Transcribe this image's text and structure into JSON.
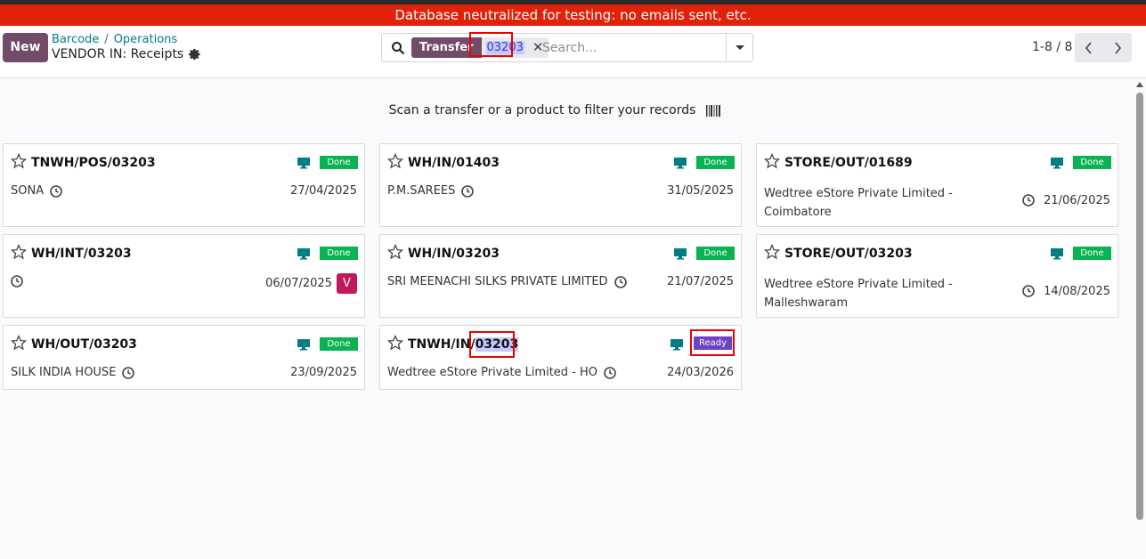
{
  "banner": {
    "text": "Database neutralized for testing: no emails sent, etc."
  },
  "control_panel": {
    "new_label": "New",
    "breadcrumbs": [
      "Barcode",
      "Operations"
    ],
    "breadcrumb_separator": "/",
    "subtitle": "VENDOR IN: Receipts"
  },
  "search": {
    "facet_label": "Transfer",
    "facet_value": "03203",
    "placeholder": "Search..."
  },
  "pager": {
    "value": "1-8 / 8"
  },
  "scan_hint": "Scan a transfer or a product to filter your records",
  "cards": [
    {
      "name": "TNWH/POS/03203",
      "status": "Done",
      "partner": "SONA",
      "date": "27/04/2025"
    },
    {
      "name": "WH/IN/01403",
      "status": "Done",
      "partner": "P.M.SAREES",
      "date": "31/05/2025"
    },
    {
      "name": "STORE/OUT/01689",
      "status": "Done",
      "partner_line1": "Wedtree eStore Private Limited -",
      "partner_line2": "Coimbatore",
      "date": "21/06/2025"
    },
    {
      "name": "WH/INT/03203",
      "status": "Done",
      "partner": "",
      "date": "06/07/2025",
      "avatar": "V"
    },
    {
      "name": "WH/IN/03203",
      "status": "Done",
      "partner": "SRI MEENACHI SILKS PRIVATE LIMITED",
      "date": "21/07/2025"
    },
    {
      "name": "STORE/OUT/03203",
      "status": "Done",
      "partner_line1": "Wedtree eStore Private Limited -",
      "partner_line2": "Malleshwaram",
      "date": "14/08/2025"
    },
    {
      "name": "WH/OUT/03203",
      "status": "Done",
      "partner": "SILK INDIA HOUSE",
      "date": "23/09/2025"
    },
    {
      "name_prefix": "TNWH/IN/",
      "name_highlight": "03203",
      "status": "Ready",
      "partner": "Wedtree eStore Private Limited - HO",
      "date": "24/03/2026"
    }
  ],
  "colors": {
    "brand": "#714b67",
    "banner": "#e0220a",
    "done": "#0ab351",
    "ready": "#6f42c1",
    "link": "#017e84",
    "highlight": "#c5c9ff",
    "annotation_box": "#ee0000"
  }
}
